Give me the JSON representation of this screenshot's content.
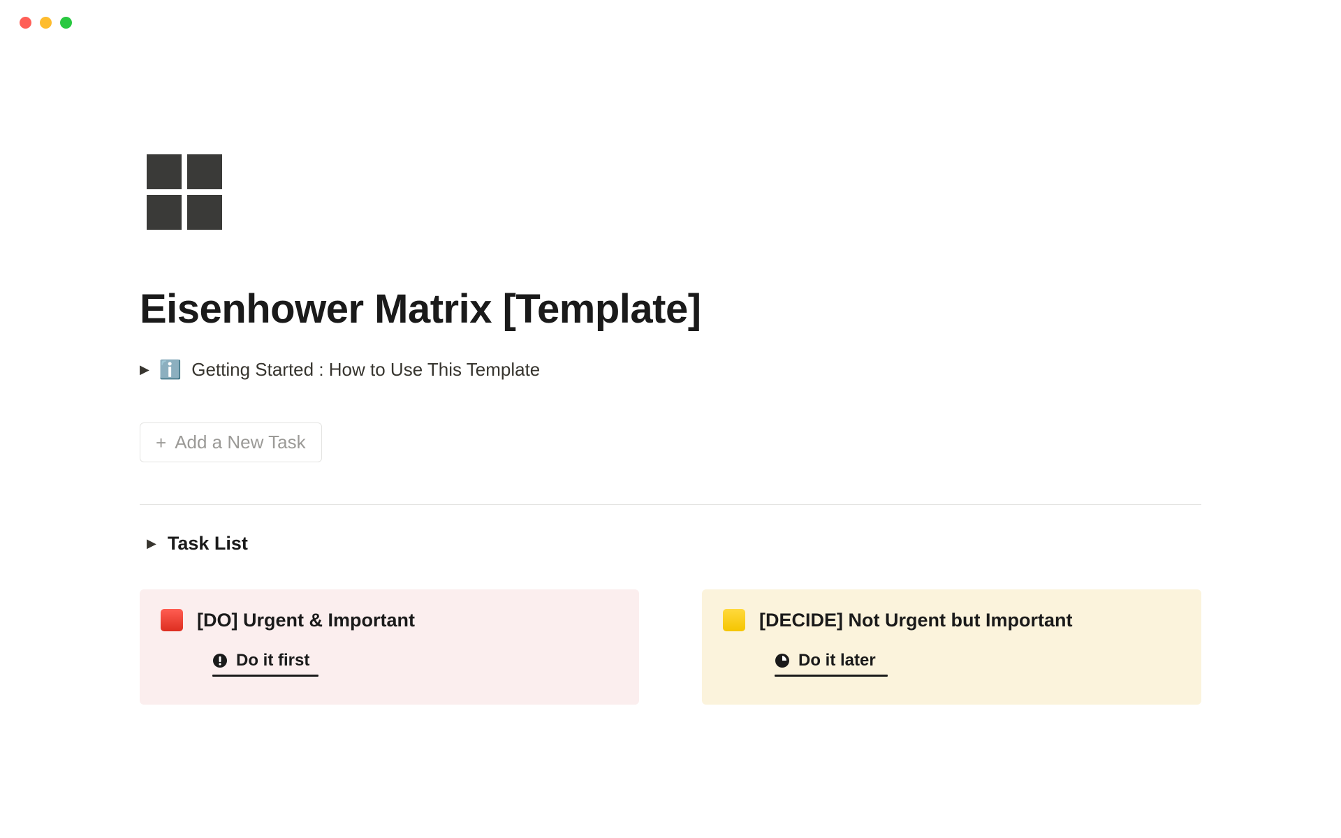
{
  "page": {
    "title": "Eisenhower Matrix [Template]"
  },
  "toggle_getting_started": {
    "emoji": "ℹ️",
    "text": "Getting Started : How to Use This Template"
  },
  "add_task": {
    "label": "Add a New Task"
  },
  "task_list": {
    "label": "Task List"
  },
  "quadrants": {
    "do": {
      "title": "[DO]  Urgent & Important",
      "subtitle": "Do it first"
    },
    "decide": {
      "title": "[DECIDE]  Not Urgent but Important",
      "subtitle": "Do it later"
    }
  }
}
